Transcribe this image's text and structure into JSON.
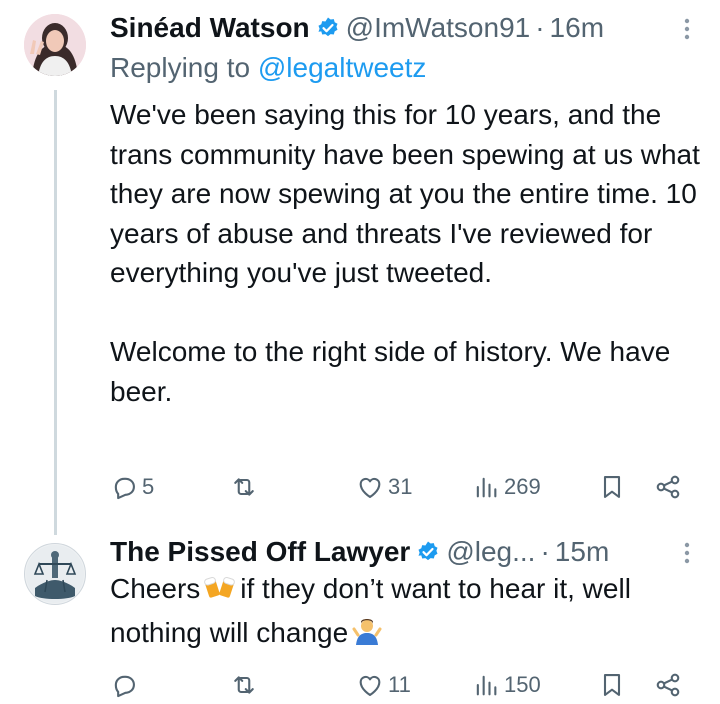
{
  "tweets": [
    {
      "author_name": "Sinéad Watson",
      "handle": "@ImWatson91",
      "separator": "·",
      "time": "16m",
      "replying_label": "Replying to ",
      "replying_to": "@legaltweetz",
      "paragraphs": [
        "We've been saying this for 10 years, and the trans community have been spewing at us what they are now spewing at you the entire time. 10 years of abuse and threats I've reviewed for everything you've just tweeted.",
        "Welcome to the right side of history. We have beer."
      ],
      "replies": "5",
      "retweets": "",
      "likes": "31",
      "views": "269"
    },
    {
      "author_name": "The Pissed Off Lawyer",
      "handle": "@leg...",
      "separator": "·",
      "time": "15m",
      "text_part1": "Cheers",
      "text_part2": "if they don’t want to hear it, well nothing will change",
      "replies": "",
      "retweets": "",
      "likes": "11",
      "views": "150"
    }
  ],
  "icons": {
    "verified": "verified-badge-icon",
    "more": "more-vertical-icon",
    "reply": "reply-icon",
    "retweet": "retweet-icon",
    "like": "heart-icon",
    "views": "views-icon",
    "bookmark": "bookmark-icon",
    "share": "share-icon",
    "emoji_beer": "clinking-beer-mugs-emoji",
    "emoji_shrug": "person-shrugging-emoji"
  },
  "colors": {
    "link": "#1d9bf0",
    "secondary_text": "#536471",
    "primary_text": "#0f1419",
    "verified": "#1d9bf0",
    "thread_line": "#cfd9de"
  }
}
